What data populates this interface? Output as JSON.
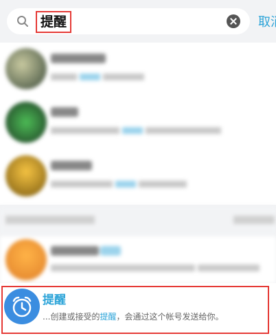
{
  "search": {
    "query": "提醒",
    "cancel_label": "取消"
  },
  "reminder_result": {
    "title": "提醒",
    "subtitle_before": "...创建或接受的",
    "subtitle_keyword": "提醒",
    "subtitle_after": "，会通过这个帐号发送给你。"
  },
  "colors": {
    "accent": "#2aa3d8",
    "highlight_box": "#e53935",
    "reminder_avatar": "#3b8de0"
  }
}
